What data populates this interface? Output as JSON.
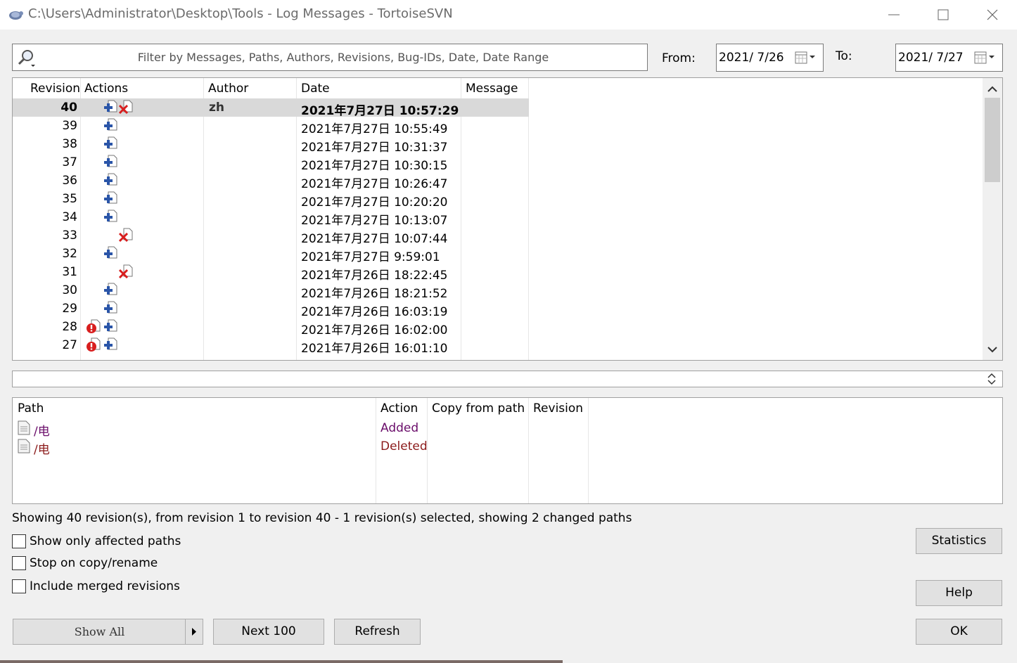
{
  "window": {
    "title": "C:\\Users\\Administrator\\Desktop\\Tools - Log Messages - TortoiseSVN"
  },
  "filter": {
    "placeholder": "Filter by Messages, Paths, Authors, Revisions, Bug-IDs, Date, Date Range",
    "from_label": "From:",
    "from_value": "2021/  7/26",
    "to_label": "To:",
    "to_value": "2021/  7/27"
  },
  "log": {
    "headers": [
      "Revision",
      "Actions",
      "Author",
      "Date",
      "Message"
    ],
    "rows": [
      {
        "revision": "40",
        "actions": [
          "added",
          "deleted"
        ],
        "author": "zh",
        "date": "2021年7月27日 10:57:29",
        "selected": true
      },
      {
        "revision": "39",
        "actions": [
          "added"
        ],
        "author": "",
        "date": "2021年7月27日 10:55:49"
      },
      {
        "revision": "38",
        "actions": [
          "added"
        ],
        "author": "",
        "date": "2021年7月27日 10:31:37"
      },
      {
        "revision": "37",
        "actions": [
          "added"
        ],
        "author": "",
        "date": "2021年7月27日 10:30:15"
      },
      {
        "revision": "36",
        "actions": [
          "added"
        ],
        "author": "",
        "date": "2021年7月27日 10:26:47"
      },
      {
        "revision": "35",
        "actions": [
          "added"
        ],
        "author": "",
        "date": "2021年7月27日 10:20:20"
      },
      {
        "revision": "34",
        "actions": [
          "added"
        ],
        "author": "",
        "date": "2021年7月27日 10:13:07"
      },
      {
        "revision": "33",
        "actions": [
          "deleted"
        ],
        "author": "",
        "date": "2021年7月27日 10:07:44"
      },
      {
        "revision": "32",
        "actions": [
          "added"
        ],
        "author": "",
        "date": "2021年7月27日 9:59:01"
      },
      {
        "revision": "31",
        "actions": [
          "deleted"
        ],
        "author": "",
        "date": "2021年7月26日 18:22:45"
      },
      {
        "revision": "30",
        "actions": [
          "added"
        ],
        "author": "",
        "date": "2021年7月26日 18:21:52"
      },
      {
        "revision": "29",
        "actions": [
          "added"
        ],
        "author": "",
        "date": "2021年7月26日 16:03:19"
      },
      {
        "revision": "28",
        "actions": [
          "conflict",
          "added"
        ],
        "author": "",
        "date": "2021年7月26日 16:02:00"
      },
      {
        "revision": "27",
        "actions": [
          "conflict",
          "added"
        ],
        "author": "",
        "date": "2021年7月26日 16:01:10"
      }
    ]
  },
  "changed_paths": {
    "headers": [
      "Path",
      "Action",
      "Copy from path",
      "Revision"
    ],
    "rows": [
      {
        "path": "/电",
        "action": "Added"
      },
      {
        "path": "/电",
        "action": "Deleted"
      }
    ]
  },
  "status_text": "Showing 40 revision(s), from revision 1 to revision 40 - 1 revision(s) selected, showing 2 changed paths",
  "options": {
    "affected_paths": "Show only affected paths",
    "stop_on_copy": "Stop on copy/rename",
    "include_merged": "Include merged revisions"
  },
  "buttons": {
    "statistics": "Statistics",
    "help": "Help",
    "show_all": "Show All",
    "next_100": "Next 100",
    "refresh": "Refresh",
    "ok": "OK"
  },
  "colors": {
    "added_action": "#6a0d6a",
    "deleted_action": "#8b1a1a",
    "selected_row": "#d9d9d9"
  }
}
